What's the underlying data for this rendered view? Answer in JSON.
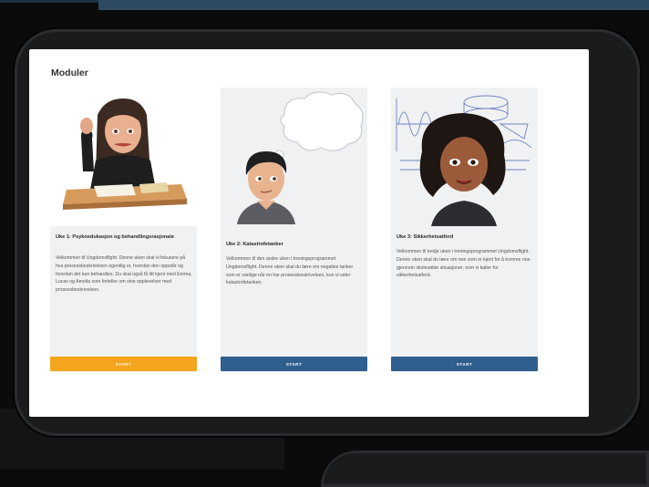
{
  "page": {
    "title": "Moduler"
  },
  "modules": [
    {
      "title": "Uke 1: Psykoedukasjon og behandlingsrasjonale",
      "description": "Velkommen til Ungdomsflight. Denne uken skal vi fokusere på hva prosessbeskrivelsen egentlig er, hvordan den oppstår og hvordan det kan behandles. Du skal også få litt kjent med Emma, Lucas og Amelia som forteller om sine opplevelser med prosessbeskrivelsen.",
      "button": "START",
      "avatar": "girl-at-desk-avatar"
    },
    {
      "title": "Uke 2: Katastrofetanker",
      "description": "Velkommen til den andre uken i treningsprogrammet Ungdomsflight. Denne uken skal du lære om negative tanker som er vanlige når en har prosessbeskrivelsen, kun vi sider katastrofetanken.",
      "button": "START",
      "avatar": "boy-thinking-avatar"
    },
    {
      "title": "Uke 3: Sikkerhetsatferd",
      "description": "Velkommen til tredje uken i treningsprogrammet Ungdomsflight. Denne uken skal du lære om noe som er kjent for å komme noe gjennom skolesøkte situasjoner, som vi kaller for sikkerhetsatferd.",
      "button": "START",
      "avatar": "girl-math-avatar"
    }
  ],
  "colors": {
    "accent_orange": "#f4a51d",
    "accent_blue": "#2f5f8f",
    "header_bar": "#2e4a63"
  }
}
